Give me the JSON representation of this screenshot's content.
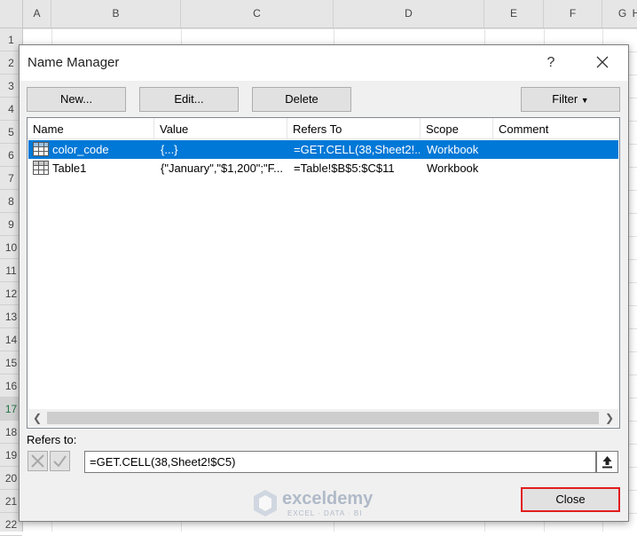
{
  "sheet": {
    "columns": [
      "A",
      "B",
      "C",
      "D",
      "E",
      "F",
      "G",
      "H"
    ],
    "rows": [
      "1",
      "2",
      "3",
      "4",
      "5",
      "6",
      "7",
      "8",
      "9",
      "10",
      "11",
      "12",
      "13",
      "14",
      "15",
      "16",
      "17",
      "18",
      "19",
      "20",
      "21",
      "22"
    ]
  },
  "dialog": {
    "title": "Name Manager",
    "help": "?",
    "buttons": {
      "new": "New...",
      "edit": "Edit...",
      "delete": "Delete",
      "filter": "Filter",
      "close": "Close"
    },
    "columns": [
      "Name",
      "Value",
      "Refers To",
      "Scope",
      "Comment"
    ],
    "rows": [
      {
        "name": "color_code",
        "value": "{...}",
        "refers_to": "=GET.CELL(38,Sheet2!...",
        "scope": "Workbook",
        "comment": "",
        "selected": true
      },
      {
        "name": "Table1",
        "value": "{\"January\",\"$1,200\";\"F...",
        "refers_to": "=Table!$B$5:$C$11",
        "scope": "Workbook",
        "comment": "",
        "selected": false
      }
    ],
    "refers_to_label": "Refers to:",
    "refers_to_value": "=GET.CELL(38,Sheet2!$C5)"
  },
  "watermark": {
    "name": "exceldemy",
    "tagline": "EXCEL · DATA · BI"
  },
  "colors": {
    "selection": "#0078d7",
    "close_highlight": "#e21d1d",
    "excel_green": "#217346"
  }
}
